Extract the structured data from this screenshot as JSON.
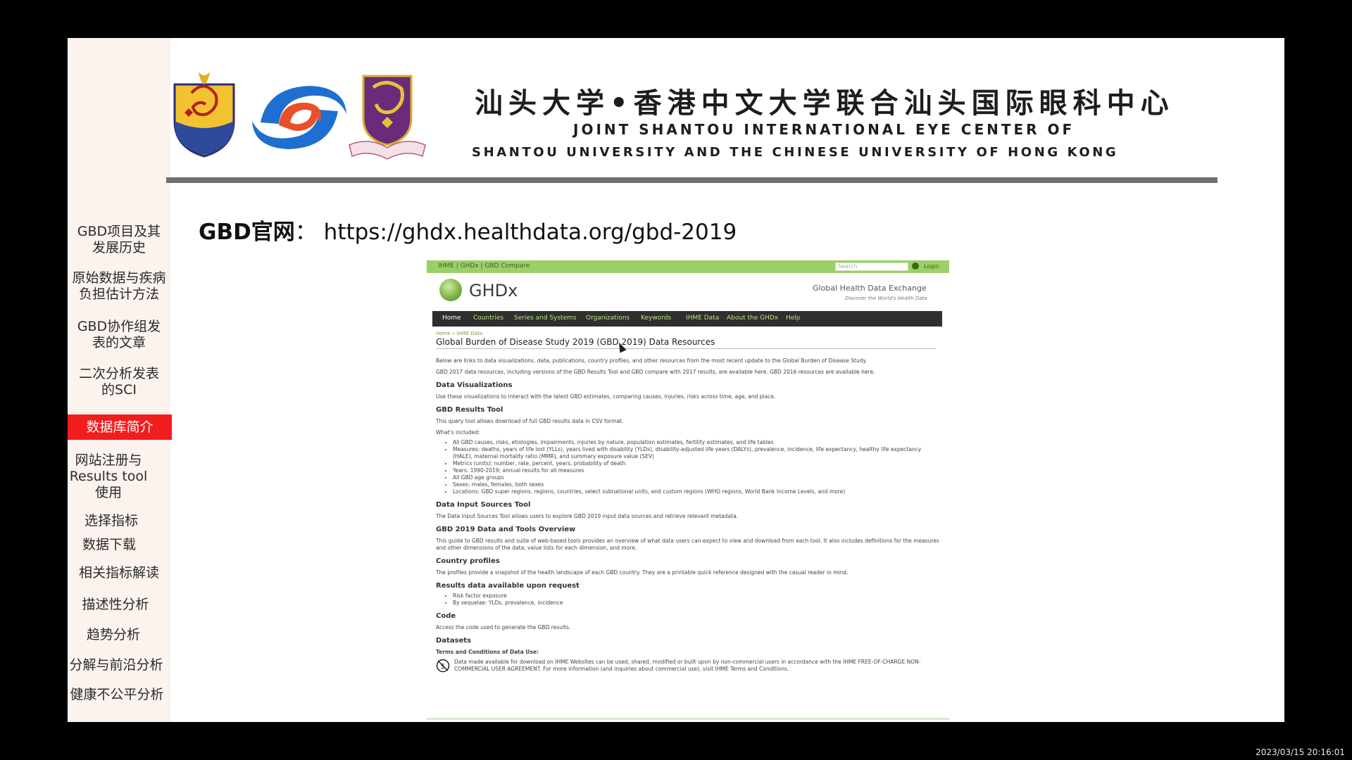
{
  "sidebar": {
    "items": [
      {
        "label": "GBD项目及其\n发展历史"
      },
      {
        "label": "原始数据与疾病\n负担估计方法"
      },
      {
        "label": "GBD协作组发\n表的文章"
      },
      {
        "label": "二次分析发表\n的SCI"
      },
      {
        "label": "数据库简介"
      },
      {
        "label": "网站注册与\nResults tool\n使用"
      },
      {
        "label": "选择指标"
      },
      {
        "label": "数据下载"
      },
      {
        "label": "相关指标解读"
      },
      {
        "label": "描述性分析"
      },
      {
        "label": "趋势分析"
      },
      {
        "label": "分解与前沿分析"
      },
      {
        "label": "健康不公平分析"
      }
    ],
    "active_index": 4,
    "active_color": "#f21d1d"
  },
  "banner": {
    "title_cn": "汕头大学•香港中文大学联合汕头国际眼科中心",
    "title_en_line1": "JOINT SHANTOU INTERNATIONAL EYE CENTER  OF",
    "title_en_line2": "SHANTOU UNIVERSITY AND THE CHINESE UNIVERSITY OF HONG KONG",
    "logos": [
      "shantou-university-crest",
      "eye-center-logo",
      "cuhk-crest"
    ]
  },
  "headline": {
    "label": "GBD官网",
    "separator": "：",
    "url": "https://ghdx.healthdata.org/gbd-2019"
  },
  "screenshot": {
    "topbar": {
      "crumbs": "IHME  |  GHDx  |  GBD Compare",
      "search_placeholder": "Search",
      "login": "Login"
    },
    "brand": {
      "name": "GHDx",
      "tagline": "Global Health Data Exchange",
      "subtagline": "Discover the World's Health Data"
    },
    "menu": [
      {
        "label": "Home",
        "color": "#ffffff"
      },
      {
        "label": "Countries",
        "color": "#b9e27d"
      },
      {
        "label": "Series and Systems",
        "color": "#b9e27d"
      },
      {
        "label": "Organizations",
        "color": "#b9e27d"
      },
      {
        "label": "Keywords",
        "color": "#b9e27d"
      },
      {
        "label": "IHME Data",
        "color": "#b9e27d"
      },
      {
        "label": "About the GHDx",
        "color": "#b9e27d"
      },
      {
        "label": "Help",
        "color": "#b9e27d"
      }
    ],
    "breadcrumb": "Home  »  IHME Data",
    "page_title": "Global Burden of Disease Study 2019 (GBD 2019) Data Resources",
    "intro": "Below are links to data visualizations, data, publications, country profiles, and other resources from the most recent update to the Global Burden of Disease Study.",
    "intro2": "GBD 2017 data resources, including versions of the GBD Results Tool and GBD compare with 2017 results, are available here. GBD 2016 resources are available here.",
    "sections": {
      "viz_h": "Data Visualizations",
      "viz_p": "Use these visualizations to interact with the latest GBD estimates, comparing causes, injuries, risks across time, age, and place.",
      "results_h": "GBD Results Tool",
      "results_p": "This query tool allows download of full GBD results data in CSV format.",
      "included": "What's included:",
      "bullets": [
        "All GBD causes, risks, etiologies, impairments, injuries by nature, population estimates, fertility estimates, and life tables",
        "Measures: deaths, years of life lost (YLLs), years lived with disability (YLDs), disability-adjusted life years (DALYs), prevalence, incidence, life expectancy, healthy life expectancy (HALE), maternal mortality ratio (MMR), and summary exposure value (SEV)",
        "Metrics (units): number, rate, percent, years, probability of death",
        "Years: 1990-2019; annual results for all measures",
        "All GBD age groups",
        "Sexes: males, females, both sexes",
        "Locations: GBD super regions, regions, countries, select subnational units, and custom regions (WHO regions, World Bank Income Levels, and more)"
      ],
      "input_h": "Data Input Sources Tool",
      "input_p": "The Data Input Sources Tool allows users to explore GBD 2019 input data sources and retrieve relevant metadata.",
      "overview_h": "GBD 2019 Data and Tools Overview",
      "overview_p": "This guide to GBD results and suite of web-based tools provides an overview of what data users can expect to view and download from each tool. It also includes definitions for the measures and other dimensions of the data, value lists for each dimension, and more.",
      "profiles_h": "Country profiles",
      "profiles_p": "The profiles provide a snapshot of the health landscape of each GBD country. They are a printable quick reference designed with the casual reader in mind.",
      "request_h": "Results data available upon request",
      "request_bullets": [
        "Risk factor exposure",
        "By sequelae: YLDs, prevalence, incidence"
      ],
      "code_h": "Code",
      "code_p": "Access the code used to generate the GBD results.",
      "datasets_h": "Datasets",
      "terms_h": "Terms and Conditions of Data Use:",
      "terms_p": "Data made available for download on IHME Websites can be used, shared, modified or built upon by non-commercial users in accordance with the IHME FREE-OF-CHARGE NON-COMMERCIAL USER AGREEMENT. For more information (and inquiries about commercial use), visit IHME Terms and Conditions."
    }
  },
  "timestamp": "2023/03/15 20:16:01"
}
